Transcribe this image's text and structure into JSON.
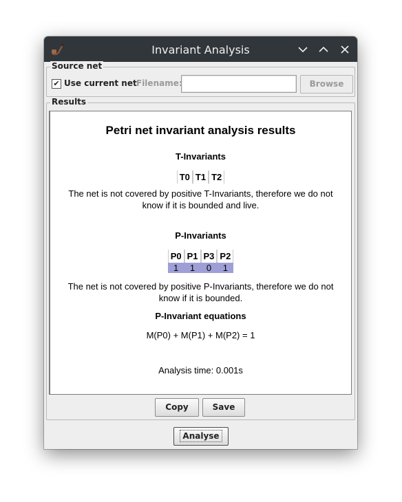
{
  "window": {
    "title": "Invariant Analysis"
  },
  "source_net": {
    "group_label": "Source net",
    "use_current_net": {
      "label": "Use current net",
      "checked": true,
      "mark": "✔"
    },
    "filename_label": "Filename:",
    "filename_value": "",
    "browse_label": "Browse"
  },
  "results": {
    "group_label": "Results",
    "heading": "Petri net invariant analysis results",
    "t_invariants": {
      "title": "T-Invariants",
      "headers": [
        "T0",
        "T1",
        "T2"
      ],
      "message_line1": "The net is not covered by positive T-Invariants, therefore we do not",
      "message_line2": "know if it is bounded and live."
    },
    "p_invariants": {
      "title": "P-Invariants",
      "headers": [
        "P0",
        "P1",
        "P3",
        "P2"
      ],
      "rows": [
        [
          "1",
          "1",
          "0",
          "1"
        ]
      ],
      "message_line1": "The net is not covered by positive P-Invariants, therefore we do not",
      "message_line2": "know if it is bounded."
    },
    "equations": {
      "title": "P-Invariant equations",
      "equation": "M(P0) + M(P1) + M(P2) = 1"
    },
    "analysis_time": "Analysis time: 0.001s",
    "copy_label": "Copy",
    "save_label": "Save"
  },
  "analyse_label": "Analyse",
  "colors": {
    "titlebar": "#31363b",
    "table_highlight": "#9f9fd8",
    "window_bg": "#eeeeee"
  },
  "icons": [
    "pipe-app-icon",
    "minimize-icon",
    "maximize-icon",
    "close-icon",
    "checkmark-icon"
  ]
}
